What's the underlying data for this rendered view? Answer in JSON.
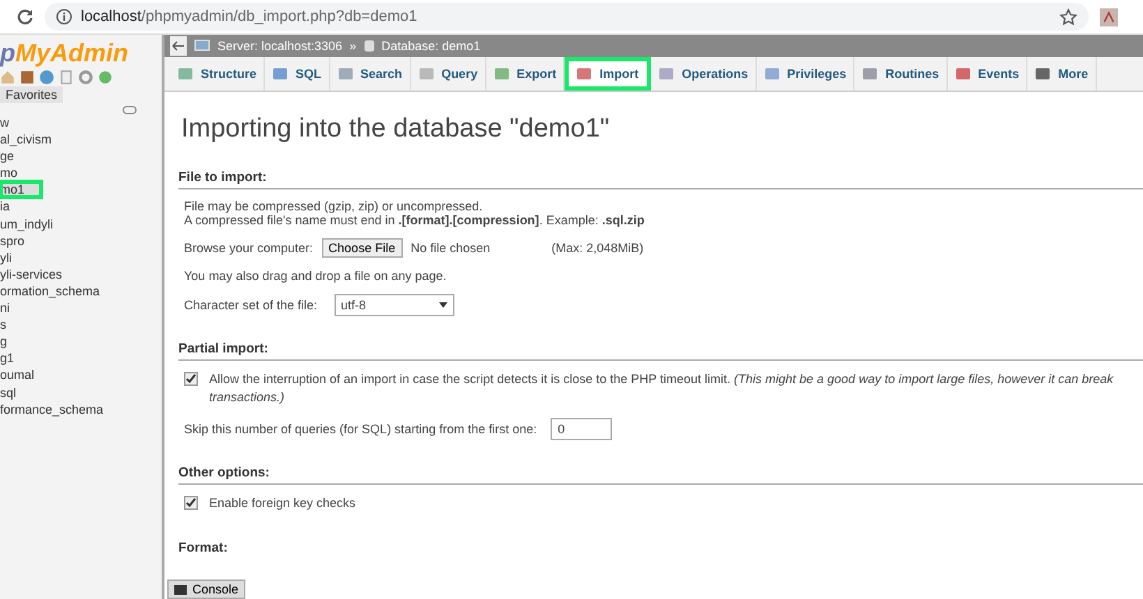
{
  "browser": {
    "url_host": "localhost",
    "url_path": "/phpmyadmin/db_import.php?db=demo1"
  },
  "sidebar": {
    "logo": {
      "part_1": "p",
      "part_2": "MyAdmin"
    },
    "favorites_tab": "Favorites",
    "items": [
      {
        "label": "w",
        "selected": false,
        "highlighted": false
      },
      {
        "label": "al_civism",
        "selected": false,
        "highlighted": false
      },
      {
        "label": "ge",
        "selected": false,
        "highlighted": false
      },
      {
        "label": "mo",
        "selected": false,
        "highlighted": false
      },
      {
        "label": "mo1",
        "selected": true,
        "highlighted": true
      },
      {
        "label": "ia",
        "selected": false,
        "highlighted": false
      },
      {
        "label": "um_indyli",
        "selected": false,
        "highlighted": false
      },
      {
        "label": "spro",
        "selected": false,
        "highlighted": false
      },
      {
        "label": "yli",
        "selected": false,
        "highlighted": false
      },
      {
        "label": "yli-services",
        "selected": false,
        "highlighted": false
      },
      {
        "label": "ormation_schema",
        "selected": false,
        "highlighted": false
      },
      {
        "label": "ni",
        "selected": false,
        "highlighted": false
      },
      {
        "label": "s",
        "selected": false,
        "highlighted": false
      },
      {
        "label": "g",
        "selected": false,
        "highlighted": false
      },
      {
        "label": "g1",
        "selected": false,
        "highlighted": false
      },
      {
        "label": "oumal",
        "selected": false,
        "highlighted": false
      },
      {
        "label": "sql",
        "selected": false,
        "highlighted": false
      },
      {
        "label": "formance_schema",
        "selected": false,
        "highlighted": false
      }
    ]
  },
  "breadcrumb": {
    "server": "Server: localhost:3306",
    "separator": "»",
    "database": "Database: demo1"
  },
  "tabs": [
    {
      "label": "Structure",
      "selected": false,
      "highlighted": false
    },
    {
      "label": "SQL",
      "selected": false,
      "highlighted": false
    },
    {
      "label": "Search",
      "selected": false,
      "highlighted": false
    },
    {
      "label": "Query",
      "selected": false,
      "highlighted": false
    },
    {
      "label": "Export",
      "selected": false,
      "highlighted": false
    },
    {
      "label": "Import",
      "selected": true,
      "highlighted": true
    },
    {
      "label": "Operations",
      "selected": false,
      "highlighted": false
    },
    {
      "label": "Privileges",
      "selected": false,
      "highlighted": false
    },
    {
      "label": "Routines",
      "selected": false,
      "highlighted": false
    },
    {
      "label": "Events",
      "selected": false,
      "highlighted": false
    },
    {
      "label": "More",
      "selected": false,
      "highlighted": false
    }
  ],
  "page_title": "Importing into the database \"demo1\"",
  "file_to_import": {
    "heading": "File to import:",
    "note_1": "File may be compressed (gzip, zip) or uncompressed.",
    "note_2": "A compressed file's name must end in **.[format].[compression]**. Example: **.sql.zip**",
    "browse_label": "Browse your computer:",
    "choose_button": "Choose File",
    "file_status": "No file chosen",
    "max_size": "(Max: 2,048MiB)",
    "drag_note": "You may also drag and drop a file on any page.",
    "charset_label": "Character set of the file:",
    "charset_value": "utf-8"
  },
  "partial_import": {
    "heading": "Partial import:",
    "allow_interrupt": {
      "checked": true,
      "label": "Allow the interruption of an import in case the script detects it is close to the PHP timeout limit. *(This might be a good way to import large files, however it can break transactions.)*"
    },
    "skip_label": "Skip this number of queries (for SQL) starting from the first one:",
    "skip_value": "0"
  },
  "other_options": {
    "heading": "Other options:",
    "foreign_key": {
      "checked": true,
      "label": "Enable foreign key checks"
    }
  },
  "format": {
    "heading": "Format:"
  },
  "console": {
    "label": "Console"
  }
}
